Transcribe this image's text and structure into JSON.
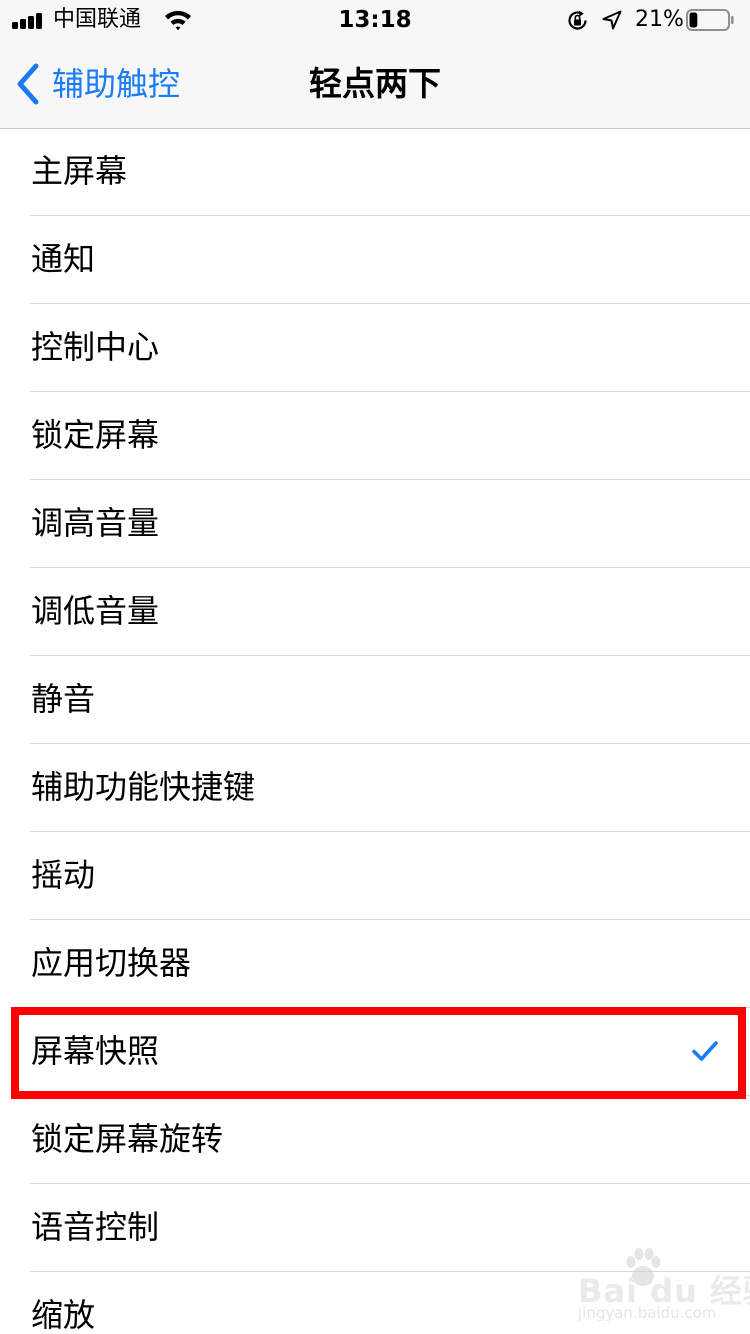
{
  "status_bar": {
    "carrier": "中国联通",
    "time": "13:18",
    "battery_percent": "21%",
    "battery_level": 0.21,
    "icons": [
      "signal-icon",
      "wifi-icon",
      "rotation-lock-icon",
      "location-icon",
      "battery-icon"
    ]
  },
  "nav": {
    "back_label": "辅助触控",
    "title": "轻点两下"
  },
  "list": {
    "items": [
      {
        "label": "主屏幕",
        "selected": false
      },
      {
        "label": "通知",
        "selected": false
      },
      {
        "label": "控制中心",
        "selected": false
      },
      {
        "label": "锁定屏幕",
        "selected": false
      },
      {
        "label": "调高音量",
        "selected": false
      },
      {
        "label": "调低音量",
        "selected": false
      },
      {
        "label": "静音",
        "selected": false
      },
      {
        "label": "辅助功能快捷键",
        "selected": false
      },
      {
        "label": "摇动",
        "selected": false
      },
      {
        "label": "应用切换器",
        "selected": false
      },
      {
        "label": "屏幕快照",
        "selected": true
      },
      {
        "label": "锁定屏幕旋转",
        "selected": false
      },
      {
        "label": "语音控制",
        "selected": false
      },
      {
        "label": "缩放",
        "selected": false
      }
    ]
  },
  "watermark": {
    "brand": "Bai du 经验",
    "sub": "jingyan.baidu.com"
  },
  "colors": {
    "accent": "#1a7cf5",
    "highlight": "#ff0000",
    "separator": "#d6d6d9",
    "bar_background": "#f7f7f7"
  }
}
